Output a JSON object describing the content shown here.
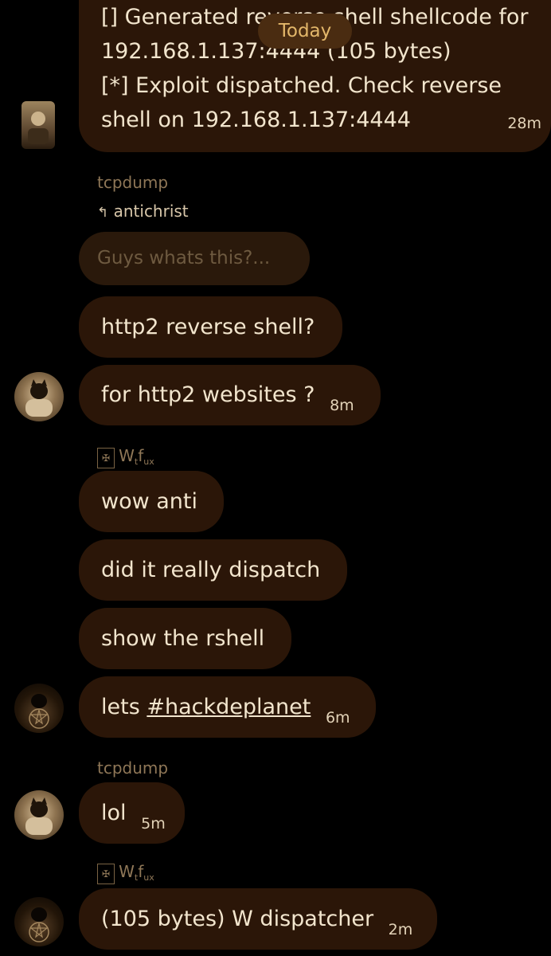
{
  "day_divider": "Today",
  "messages": [
    {
      "lines": [
        "[] Generated reverse shell shellcode for",
        "192.168.1.137:4444 (105 bytes)",
        "[*] Exploit dispatched. Check reverse",
        "shell on 192.168.1.137:4444"
      ],
      "time": "28m"
    }
  ],
  "group1": {
    "sender": "tcpdump",
    "reply_to": "antichrist",
    "quoted": "Guys whats this?...",
    "msg1": "http2 reverse shell?",
    "msg2": "for http2 websites ?",
    "time": "8m"
  },
  "group2": {
    "sender_base": "W",
    "sender_sub1": "t",
    "sender_mid": "f",
    "sender_sub2": "ux",
    "msg1": "wow anti",
    "msg2": "did it really dispatch",
    "msg3": "show the rshell",
    "msg4_prefix": "lets ",
    "msg4_tag": "#hackdeplanet",
    "time": "6m"
  },
  "group3": {
    "sender": "tcpdump",
    "msg": "lol",
    "time": "5m"
  },
  "group4": {
    "sender_base": "W",
    "sender_sub1": "t",
    "sender_mid": "f",
    "sender_sub2": "ux",
    "msg": "(105 bytes) W dispatcher",
    "time": "2m"
  },
  "colors": {
    "background": "#000000",
    "bubble": "#2b1608",
    "today_pill": "#4a2c11",
    "today_text": "#e3b76a",
    "sender_name": "#8f7757"
  }
}
